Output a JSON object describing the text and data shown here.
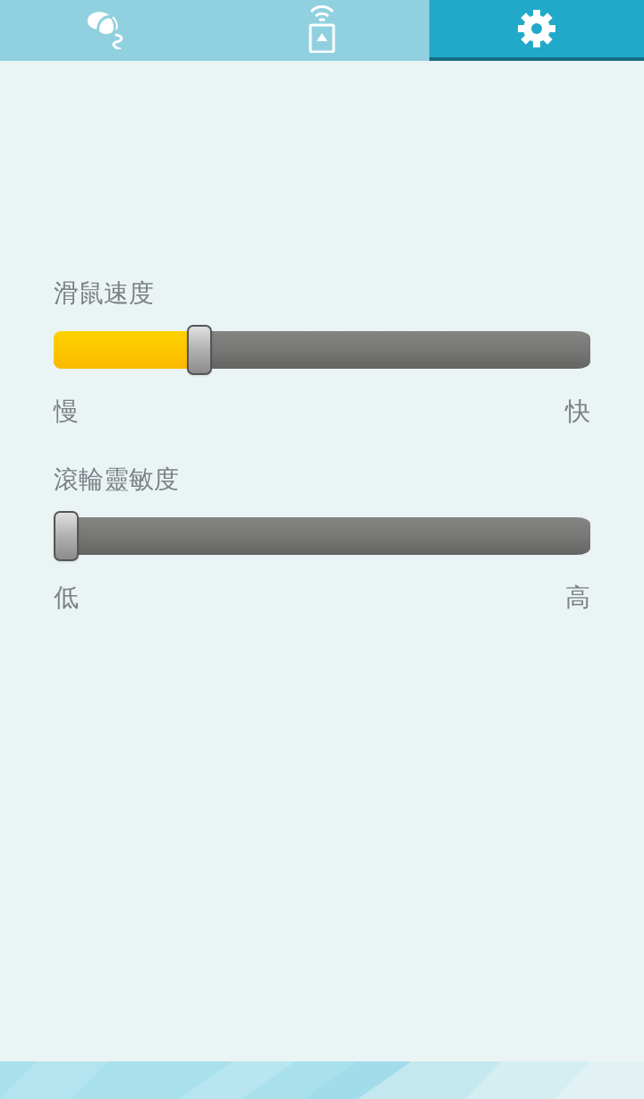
{
  "tabs": [
    {
      "kind": "mouse",
      "selected": false
    },
    {
      "kind": "remote",
      "selected": false
    },
    {
      "kind": "settings",
      "selected": true
    }
  ],
  "sliders": [
    {
      "label": "滑鼠速度",
      "level": 0.26,
      "min_label": "慢",
      "max_label": "快"
    },
    {
      "label": "滾輪靈敏度",
      "level": 0,
      "min_label": "低",
      "max_label": "高"
    }
  ]
}
